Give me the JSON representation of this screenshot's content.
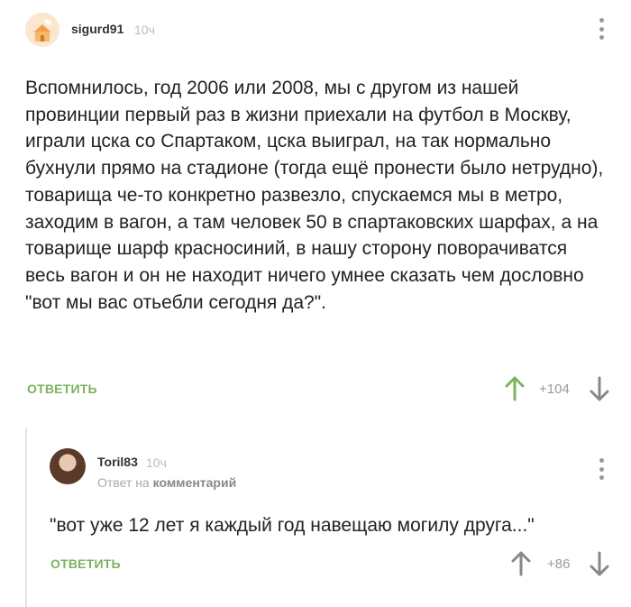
{
  "comment": {
    "username": "sigurd91",
    "time": "10ч",
    "text": "Вспомнилось, год 2006 или 2008, мы с другом из нашей провинции первый раз в жизни приехали на футбол в Москву, играли цска со Спартаком, цска выиграл, на так нормально бухнули прямо на стадионе (тогда ещё пронести было нетрудно), товарища че-то конкретно развезло, спускаемся мы в метро, заходим в вагон, а там человек 50 в спартаковских шарфах, а на товарище шарф красносиний, в нашу сторону поворачиватся весь вагон и он не находит ничего умнее сказать чем дословно \"вот мы вас отьебли сегодня да?\".",
    "reply_label": "ОТВЕТИТЬ",
    "rating": "+104"
  },
  "reply": {
    "username": "Toril83",
    "time": "10ч",
    "hint_prefix": "Ответ на",
    "hint_link": "комментарий",
    "text": "\"вот уже 12 лет я каждый год навещаю могилу друга...\"",
    "reply_label": "ОТВЕТИТЬ",
    "rating": "+86"
  },
  "colors": {
    "accent": "#7bb35f",
    "muted": "#999999"
  }
}
